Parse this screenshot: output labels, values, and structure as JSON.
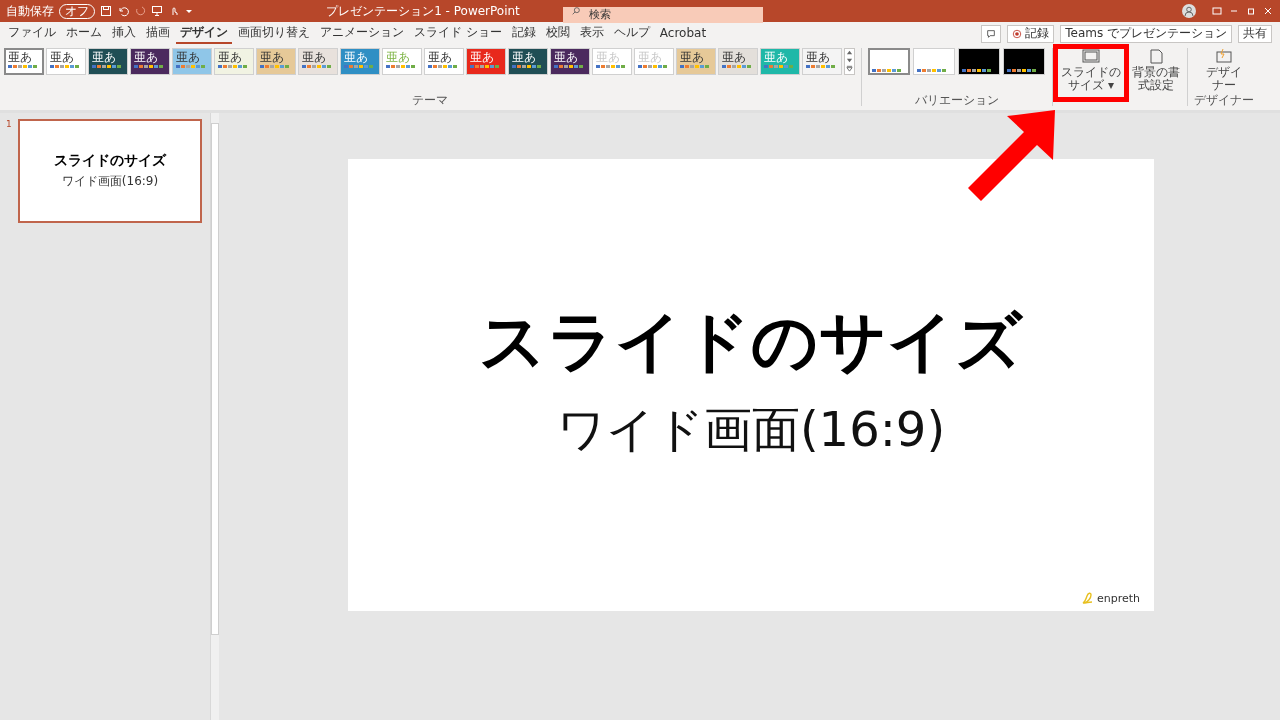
{
  "title_bar": {
    "autosave_label": "自動保存",
    "autosave_toggle": {
      "label": "オフ",
      "on": false
    },
    "title": "プレゼンテーション1 - PowerPoint",
    "search": {
      "placeholder": "検索"
    }
  },
  "tabs": [
    {
      "label": "ファイル",
      "selected": false
    },
    {
      "label": "ホーム",
      "selected": false
    },
    {
      "label": "挿入",
      "selected": false
    },
    {
      "label": "描画",
      "selected": false
    },
    {
      "label": "デザイン",
      "selected": true
    },
    {
      "label": "画面切り替え",
      "selected": false
    },
    {
      "label": "アニメーション",
      "selected": false
    },
    {
      "label": "スライド ショー",
      "selected": false
    },
    {
      "label": "記録",
      "selected": false
    },
    {
      "label": "校閲",
      "selected": false
    },
    {
      "label": "表示",
      "selected": false
    },
    {
      "label": "ヘルプ",
      "selected": false
    },
    {
      "label": "Acrobat",
      "selected": false
    }
  ],
  "ribbon_actions": [
    {
      "kind": "comment"
    },
    {
      "kind": "record",
      "label": "記録"
    },
    {
      "kind": "teams",
      "label": "Teams でプレゼンテーション"
    },
    {
      "kind": "share",
      "label": "共有"
    }
  ],
  "themes": [
    {
      "label": "亜あ",
      "kind": "light",
      "color": "#ffffff",
      "selected": true
    },
    {
      "label": "亜あ",
      "kind": "light",
      "color": "#ffffff",
      "selected": false
    },
    {
      "label": "亜あ",
      "kind": "dark",
      "color": "#1f4e55",
      "selected": false
    },
    {
      "label": "亜あ",
      "kind": "dark",
      "color": "#4b2a5e",
      "selected": false
    },
    {
      "label": "亜あ",
      "kind": "light",
      "color": "#8fc6e8",
      "selected": false
    },
    {
      "label": "亜あ",
      "kind": "light",
      "color": "#f1f3e3",
      "selected": false
    },
    {
      "label": "亜あ",
      "kind": "light",
      "color": "#e6c998",
      "selected": false
    },
    {
      "label": "亜あ",
      "kind": "light",
      "color": "#e8e1dc",
      "selected": false
    },
    {
      "label": "亜あ",
      "kind": "dark",
      "color": "#2f8fc4",
      "selected": false
    },
    {
      "label": "亜あ",
      "kind": "accent",
      "color": "#ffffff",
      "selected": false
    },
    {
      "label": "亜あ",
      "kind": "light",
      "color": "#ffffff",
      "selected": false
    },
    {
      "label": "亜あ",
      "kind": "dark",
      "color": "#e8291c",
      "selected": false
    },
    {
      "label": "亜あ",
      "kind": "dark",
      "color": "#1f4e55",
      "selected": false
    },
    {
      "label": "亜あ",
      "kind": "dark",
      "color": "#4b2a5e",
      "selected": false
    },
    {
      "label": "亜あ",
      "kind": "faint",
      "color": "#ffffff",
      "selected": false
    },
    {
      "label": "亜あ",
      "kind": "faint",
      "color": "#ffffff",
      "selected": false
    },
    {
      "label": "亜あ",
      "kind": "light",
      "color": "#e6c998",
      "selected": false
    },
    {
      "label": "亜あ",
      "kind": "light",
      "color": "#e3dfda",
      "selected": false
    },
    {
      "label": "亜あ",
      "kind": "dark",
      "color": "#1fb8a8",
      "selected": false
    },
    {
      "label": "亜あ",
      "kind": "light",
      "color": "#f4f4f4",
      "selected": false
    }
  ],
  "themes_group_label": "テーマ",
  "variations": [
    {
      "color": "#ffffff",
      "selected": true
    },
    {
      "color": "#ffffff",
      "selected": false
    },
    {
      "color": "#000000",
      "selected": false
    },
    {
      "color": "#000000",
      "selected": false
    }
  ],
  "variations_group_label": "バリエーション",
  "customize_buttons": [
    {
      "kind": "slide_size",
      "label": "スライドのサイズ",
      "caret": "▾"
    },
    {
      "kind": "background",
      "label": "背景の書式設定"
    }
  ],
  "designer": {
    "label": "デザイナー",
    "group_label": "デザイナー"
  },
  "thumbnails": [
    {
      "number": "1",
      "title": "スライドのサイズ",
      "subtitle": "ワイド画面(16:9)",
      "selected": true
    }
  ],
  "slide": {
    "title": "スライドのサイズ",
    "subtitle": "ワイド画面(16:9)",
    "logo": "enpreth"
  },
  "annotation": {
    "highlight": true,
    "arrow": true
  }
}
